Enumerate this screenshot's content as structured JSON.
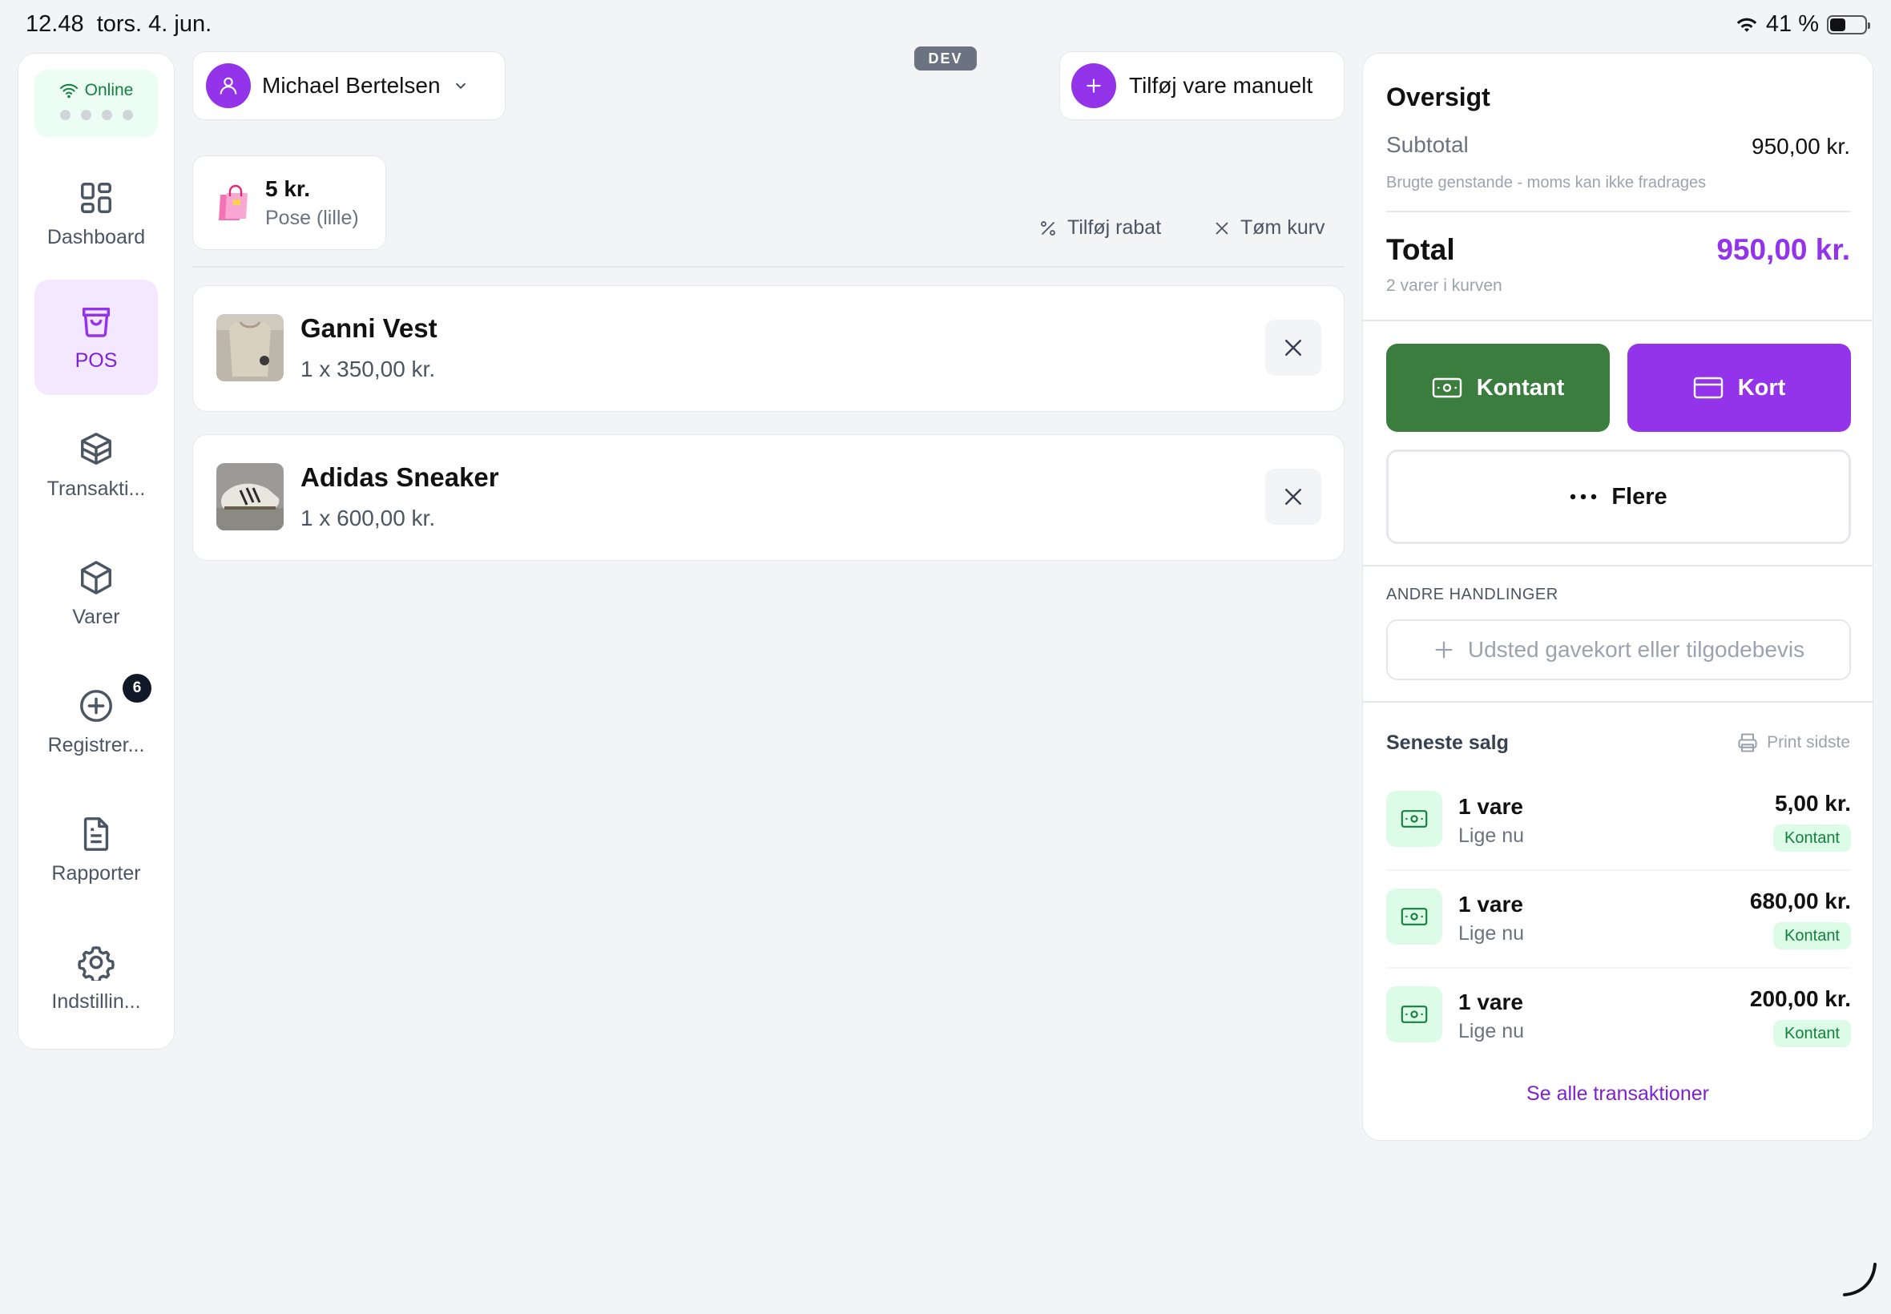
{
  "status_bar": {
    "time": "12.48",
    "date": "tors. 4. jun.",
    "battery": "41 %",
    "battery_level": 0.41
  },
  "sidebar": {
    "connection": {
      "label": "Online",
      "color": "#15803d"
    },
    "items": [
      {
        "label": "Dashboard",
        "icon": "dashboard-icon",
        "active": false
      },
      {
        "label": "POS",
        "icon": "shopping-bag-icon",
        "active": true
      },
      {
        "label": "Transakti...",
        "icon": "transactions-box-icon",
        "active": false
      },
      {
        "label": "Varer",
        "icon": "package-icon",
        "active": false
      },
      {
        "label": "Registrer...",
        "icon": "plus-circle-icon",
        "active": false,
        "badge": "6"
      },
      {
        "label": "Rapporter",
        "icon": "document-icon",
        "active": false
      },
      {
        "label": "Indstillin...",
        "icon": "gear-icon",
        "active": false
      }
    ]
  },
  "header": {
    "customer_name": "Michael Bertelsen",
    "env_badge": "DEV",
    "add_manual_label": "Tilføj vare manuelt"
  },
  "quick_product": {
    "price": "5 kr.",
    "name": "Pose (lille)"
  },
  "cart_actions": {
    "discount_label": "Tilføj rabat",
    "clear_label": "Tøm kurv"
  },
  "cart": {
    "items": [
      {
        "name": "Ganni Vest",
        "qty_price": "1 x 350,00 kr."
      },
      {
        "name": "Adidas Sneaker",
        "qty_price": "1 x 600,00 kr."
      }
    ]
  },
  "summary": {
    "title": "Oversigt",
    "subtotal_label": "Subtotal",
    "subtotal_value": "950,00 kr.",
    "vat_note": "Brugte genstande - moms kan ikke fradrages",
    "total_label": "Total",
    "total_value": "950,00 kr.",
    "items_count": "2 varer i kurven",
    "accent": "#9333ea"
  },
  "payment": {
    "cash_label": "Kontant",
    "card_label": "Kort",
    "more_label": "Flere",
    "cash_color": "#3a7d3e",
    "card_color": "#9333ea"
  },
  "other_actions": {
    "title": "ANDRE HANDLINGER",
    "gift_label": "Udsted gavekort eller tilgodebevis"
  },
  "recent_sales": {
    "title": "Seneste salg",
    "print_label": "Print sidste",
    "sales": [
      {
        "count": "1 vare",
        "time": "Lige nu",
        "amount": "5,00 kr.",
        "method": "Kontant"
      },
      {
        "count": "1 vare",
        "time": "Lige nu",
        "amount": "680,00 kr.",
        "method": "Kontant"
      },
      {
        "count": "1 vare",
        "time": "Lige nu",
        "amount": "200,00 kr.",
        "method": "Kontant"
      }
    ],
    "see_all_label": "Se alle transaktioner"
  }
}
